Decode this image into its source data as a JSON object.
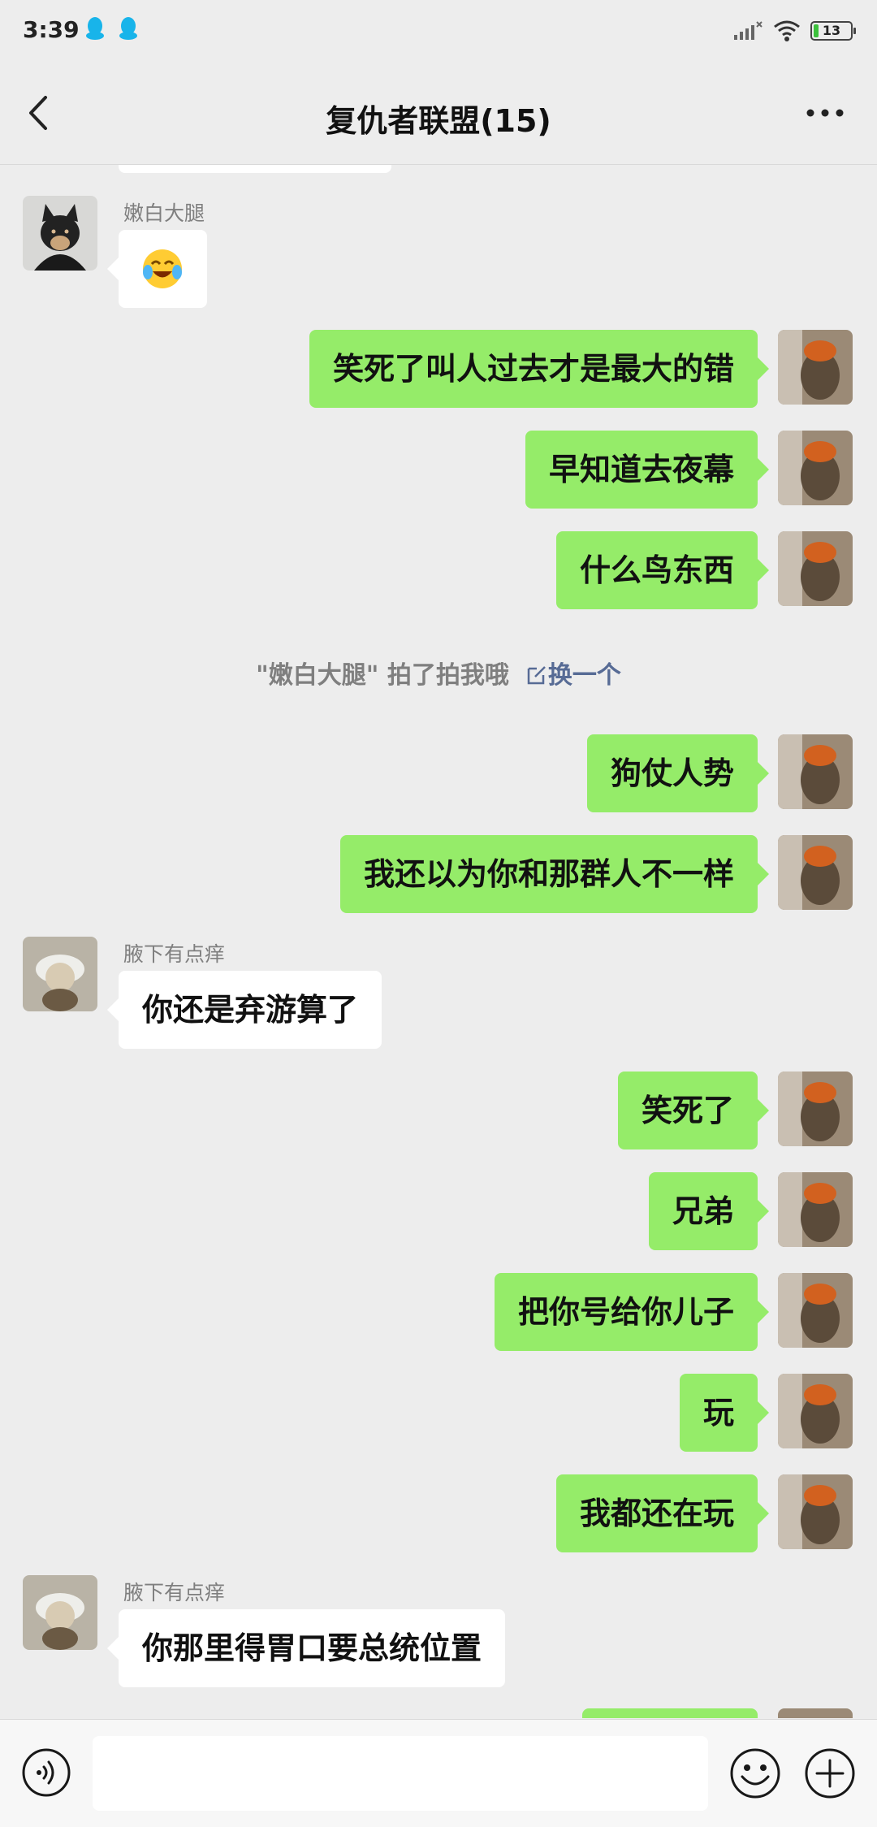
{
  "status_bar": {
    "time": "3:39",
    "battery_level": "13",
    "icons": [
      "qq-icon",
      "qq-icon",
      "signal-icon",
      "wifi-icon",
      "battery-icon"
    ]
  },
  "header": {
    "title": "复仇者联盟(15)",
    "back_icon": "chevron-left-icon",
    "more_icon": "more-dots-icon"
  },
  "messages": [
    {
      "type": "incoming",
      "sender": "嫩白大腿",
      "text": "",
      "emoji": "crying-laughing-emoji"
    },
    {
      "type": "outgoing",
      "text": "笑死了叫人过去才是最大的错"
    },
    {
      "type": "outgoing",
      "text": "早知道去夜幕"
    },
    {
      "type": "outgoing",
      "text": "什么鸟东西"
    },
    {
      "type": "system",
      "text": "\"嫩白大腿\" 拍了拍我哦",
      "action": "换一个"
    },
    {
      "type": "outgoing",
      "text": "狗仗人势"
    },
    {
      "type": "outgoing",
      "text": "我还以为你和那群人不一样"
    },
    {
      "type": "incoming",
      "sender": "腋下有点痒",
      "text": "你还是弃游算了"
    },
    {
      "type": "outgoing",
      "text": "笑死了"
    },
    {
      "type": "outgoing",
      "text": "兄弟"
    },
    {
      "type": "outgoing",
      "text": "把你号给你儿子"
    },
    {
      "type": "outgoing",
      "text": "玩"
    },
    {
      "type": "outgoing",
      "text": "我都还在玩"
    },
    {
      "type": "incoming",
      "sender": "腋下有点痒",
      "text": "你那里得胃口要总统位置"
    }
  ],
  "input_bar": {
    "placeholder": "",
    "voice_icon": "voice-icon",
    "emoji_icon": "emoji-icon",
    "plus_icon": "plus-icon"
  },
  "colors": {
    "background": "#ededed",
    "outgoing_bubble": "#95ec69",
    "incoming_bubble": "#ffffff",
    "link": "#576b95"
  }
}
